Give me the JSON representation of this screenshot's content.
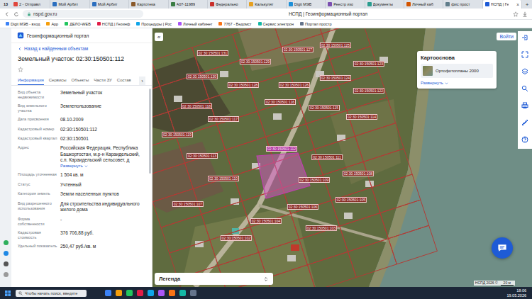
{
  "browser": {
    "tab_count": "13",
    "tabs": [
      {
        "label": "2 - Отправл",
        "selected": false,
        "color": "#e0463c"
      },
      {
        "label": "Мой Арбит",
        "selected": false,
        "color": "#2c6fbf"
      },
      {
        "label": "Мой Арбит",
        "selected": false,
        "color": "#2c6fbf"
      },
      {
        "label": "Картотека",
        "selected": false,
        "color": "#8a5a2b"
      },
      {
        "label": "А07-11989",
        "selected": false,
        "color": "#3a7d44"
      },
      {
        "label": "Федерально",
        "selected": false,
        "color": "#c9302c"
      },
      {
        "label": "Калькулят",
        "selected": false,
        "color": "#e6a020"
      },
      {
        "label": "Digit МЭВ",
        "selected": false,
        "color": "#1d8fd8"
      },
      {
        "label": "Реестр изо",
        "selected": false,
        "color": "#7b4fb0"
      },
      {
        "label": "Документы",
        "selected": false,
        "color": "#2a9d8f"
      },
      {
        "label": "Личный каб",
        "selected": false,
        "color": "#d35400"
      },
      {
        "label": "фис прост",
        "selected": false,
        "color": "#607d8b"
      },
      {
        "label": "НСПД | Ге",
        "selected": true,
        "color": "#1e5bd6"
      }
    ],
    "close_tab": "×",
    "new_tab": "+",
    "address": "nspd.gov.ru",
    "page_title": "НСПД | Геоинформационный портал",
    "bookmarks": [
      "Digit МЭВ - вход",
      "App",
      "ДЕЛО-WEB",
      "НСПД | Геоинф",
      "Процедуры | Рос",
      "Личный кабинет",
      "7767 - Ведомст",
      "Сервис электрон",
      "Портал простр"
    ]
  },
  "header": {
    "title": "Геоинформационный портал",
    "login": "Войти"
  },
  "panel": {
    "back": "Назад к найденным объектам",
    "title": "Земельный участок: 02:30:150501:112",
    "tabs": [
      {
        "label": "Информация",
        "selected": true
      },
      {
        "label": "Сервисы",
        "selected": false
      },
      {
        "label": "Объекты",
        "selected": false
      },
      {
        "label": "Части ЗУ",
        "selected": false
      },
      {
        "label": "Состав",
        "selected": false
      }
    ],
    "tabs_more": "›",
    "fields": [
      {
        "label": "Вид объекта недвижимости",
        "value": "Земельный участок"
      },
      {
        "label": "Вид земельного участка",
        "value": "Землепользование"
      },
      {
        "label": "Дата присвоения",
        "value": "08.10.2009"
      },
      {
        "label": "Кадастровый номер",
        "value": "02:30:150501:112"
      },
      {
        "label": "Кадастровый квартал",
        "value": "02:30:150501"
      },
      {
        "label": "Адрес",
        "value": "Российская Федерация, Республика Башкортостан, м.р-н Караидельский, с.п. Караидельский сельсовет, д",
        "link": "Развернуть"
      },
      {
        "label": "Площадь уточненная",
        "value": "1 504 кв. м"
      },
      {
        "label": "Статус",
        "value": "Учтенный"
      },
      {
        "label": "Категория земель",
        "value": "Земли населенных пунктов"
      },
      {
        "label": "Вид разрешенного использования",
        "value": "Для строительства индивидуального жилого дома"
      },
      {
        "label": "Форма собственности",
        "value": "-"
      },
      {
        "label": "Кадастровая стоимость",
        "value": "376 706,88 руб."
      },
      {
        "label": "Удельный показатель",
        "value": "250,47 руб./кв. м"
      }
    ]
  },
  "map": {
    "collapse": "«",
    "parcels": [
      {
        "label": "02:30:150501:131",
        "selected": false
      },
      {
        "label": "02:30:150501:129",
        "selected": false
      },
      {
        "label": "02:30:150501:127",
        "selected": false
      },
      {
        "label": "02:30:150501:125",
        "selected": false
      },
      {
        "label": "02:30:150501:123",
        "selected": false
      },
      {
        "label": "02:30:150501:130",
        "selected": false
      },
      {
        "label": "02:30:150501:128",
        "selected": false
      },
      {
        "label": "02:30:150501:126",
        "selected": false
      },
      {
        "label": "02:30:150501:124",
        "selected": false
      },
      {
        "label": "02:30:150501:122",
        "selected": false
      },
      {
        "label": "02:30:150501:118",
        "selected": false
      },
      {
        "label": "02:30:150501:117",
        "selected": false
      },
      {
        "label": "02:30:150501:116",
        "selected": false
      },
      {
        "label": "02:30:150501:115",
        "selected": false
      },
      {
        "label": "02:30:150501:114",
        "selected": false
      },
      {
        "label": "02:30:150501:119",
        "selected": false
      },
      {
        "label": "02:30:150501:113",
        "selected": false
      },
      {
        "label": "02:30:150501:112",
        "selected": true
      },
      {
        "label": "02:30:150501:111",
        "selected": false
      },
      {
        "label": "02:30:150501:110",
        "selected": false
      },
      {
        "label": "02:30:150501:109",
        "selected": false
      },
      {
        "label": "02:30:150501:108",
        "selected": false
      },
      {
        "label": "02:30:150501:107",
        "selected": false
      },
      {
        "label": "02:30:150501:106",
        "selected": false
      },
      {
        "label": "02:30:150501:105",
        "selected": false
      },
      {
        "label": "02:30:150501:104",
        "selected": false
      },
      {
        "label": "02:30:150501:103",
        "selected": false
      },
      {
        "label": "02:30:150501:102",
        "selected": false
      }
    ],
    "basemap": {
      "title": "Картооснова",
      "layer": "Ортофотопланы 2000",
      "expand": "Развернуть"
    },
    "legend": "Легенда",
    "attribution": "НСПД 2026 ©",
    "scale": "20 м"
  },
  "taskbar": {
    "search": "Чтобы начать поиск, введите",
    "time": "18:06",
    "date": "19.05.2026"
  }
}
